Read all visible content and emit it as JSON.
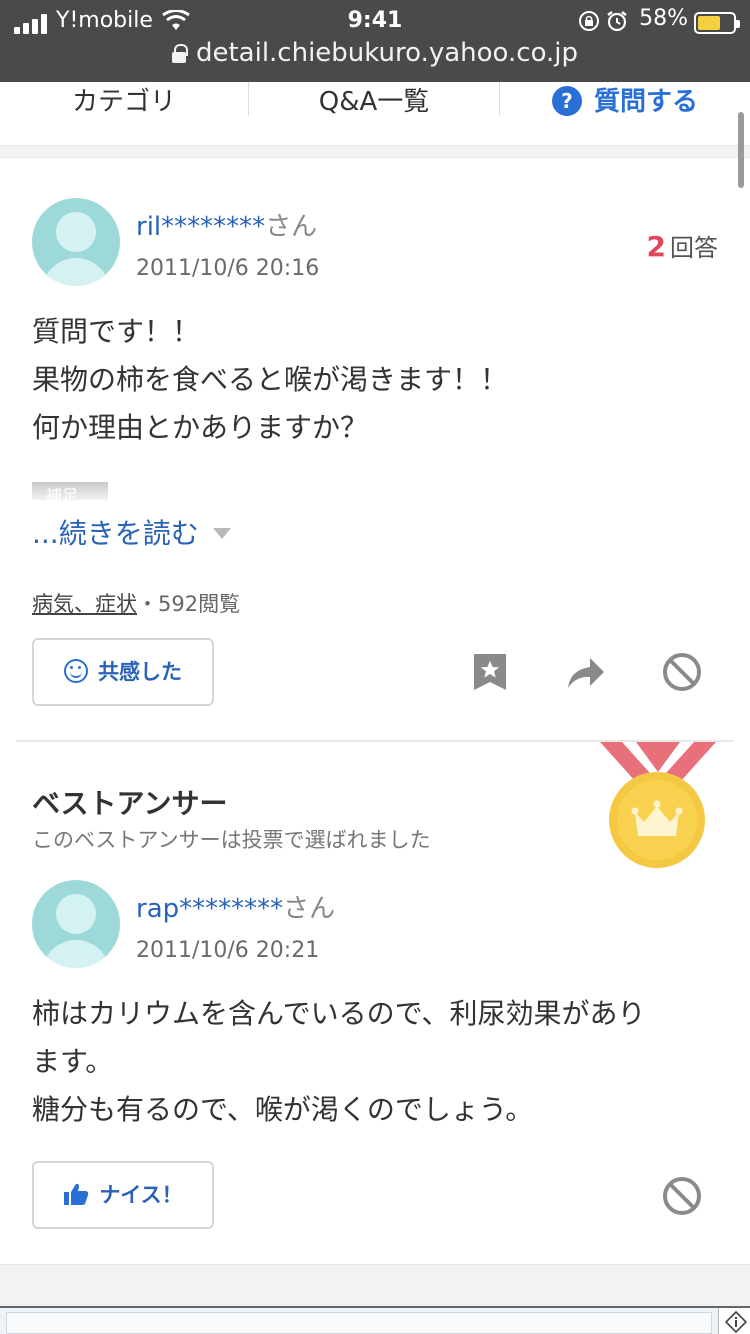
{
  "status_bar": {
    "carrier": "Y!mobile",
    "time": "9:41",
    "battery_percent": "58%",
    "url": "detail.chiebukuro.yahoo.co.jp"
  },
  "tabs": {
    "category": "カテゴリ",
    "qa_list": "Q&A一覧",
    "ask": "質問する",
    "ask_icon_glyph": "?"
  },
  "question": {
    "user": "ril********",
    "user_suffix": "さん",
    "date": "2011/10/6 20:16",
    "answer_count_num": "2",
    "answer_count_label": "回答",
    "body_lines": [
      "質問です！！",
      "果物の柿を食べると喉が渇きます！！",
      "何か理由とかありますか？"
    ],
    "supplement_tag": "補足",
    "read_more": "...続きを読む",
    "category": "病気、症状",
    "views": "・592閲覧",
    "empathy_button": "共感した"
  },
  "best_answer": {
    "title": "ベストアンサー",
    "subtitle": "このベストアンサーは投票で選ばれました",
    "user": "rap********",
    "user_suffix": "さん",
    "date": "2011/10/6 20:21",
    "body_lines": [
      "柿はカリウムを含んでいるので、利尿効果があり",
      "ます。",
      "糖分も有るので、喉が渇くのでしょう。"
    ],
    "nice_button": "ナイス！"
  },
  "colors": {
    "link_blue": "#2a62b8",
    "accent_red": "#e0495c",
    "medal_gold": "#f5c843",
    "ribbon": "#e8707a"
  }
}
